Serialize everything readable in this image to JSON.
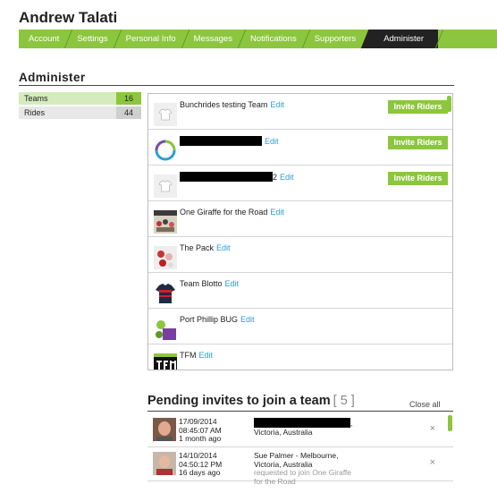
{
  "profile": {
    "name": "Andrew Talati"
  },
  "tabs": [
    {
      "label": "Account",
      "active": false
    },
    {
      "label": "Settings",
      "active": false
    },
    {
      "label": "Personal Info",
      "active": false
    },
    {
      "label": "Messages",
      "active": false
    },
    {
      "label": "Notifications",
      "active": false
    },
    {
      "label": "Supporters",
      "active": false
    },
    {
      "label": "Administer",
      "active": true
    }
  ],
  "section": {
    "title": "Administer"
  },
  "leftnav": [
    {
      "label": "Teams",
      "count": "16",
      "active": true
    },
    {
      "label": "Rides",
      "count": "44",
      "active": false
    }
  ],
  "teams": {
    "edit_label": "Edit",
    "invite_label": "Invite Riders",
    "rows": [
      {
        "name": "Bunchrides testing Team",
        "logo": "shirt-icon",
        "invite": true,
        "redacted": false
      },
      {
        "name": "",
        "logo": "ring-logo",
        "invite": true,
        "redacted": true
      },
      {
        "name": "2",
        "logo": "shirt-icon",
        "invite": true,
        "redacted": true
      },
      {
        "name": "One Giraffe for the Road",
        "logo": "team-photo",
        "invite": false,
        "redacted": false
      },
      {
        "name": "The Pack",
        "logo": "team-photo",
        "invite": false,
        "redacted": false
      },
      {
        "name": "Team Blotto",
        "logo": "jersey-logo",
        "invite": false,
        "redacted": false
      },
      {
        "name": "Port Phillip BUG",
        "logo": "bug-logo",
        "invite": false,
        "redacted": false
      },
      {
        "name": "TFM",
        "logo": "tfm-logo",
        "invite": false,
        "redacted": false
      }
    ]
  },
  "pending": {
    "title": "Pending invites to join a team",
    "count": "[ 5 ]",
    "close_all": "Close all",
    "close_icon": "×",
    "items": [
      {
        "date": "17/09/2014",
        "time": "08:45:07 AM",
        "ago": "1 month ago",
        "line1": ",",
        "line2": "Victoria, Australia",
        "sub": ""
      },
      {
        "date": "14/10/2014",
        "time": "04:50:12 PM",
        "ago": "16 days ago",
        "line1": "Sue Palmer - Melbourne,",
        "line2": "Victoria, Australia",
        "sub": "requested to join One Giraffe for the Road"
      }
    ]
  },
  "colors": {
    "accent": "#8cc63f",
    "link": "#2a9fd6",
    "dark": "#222222"
  }
}
